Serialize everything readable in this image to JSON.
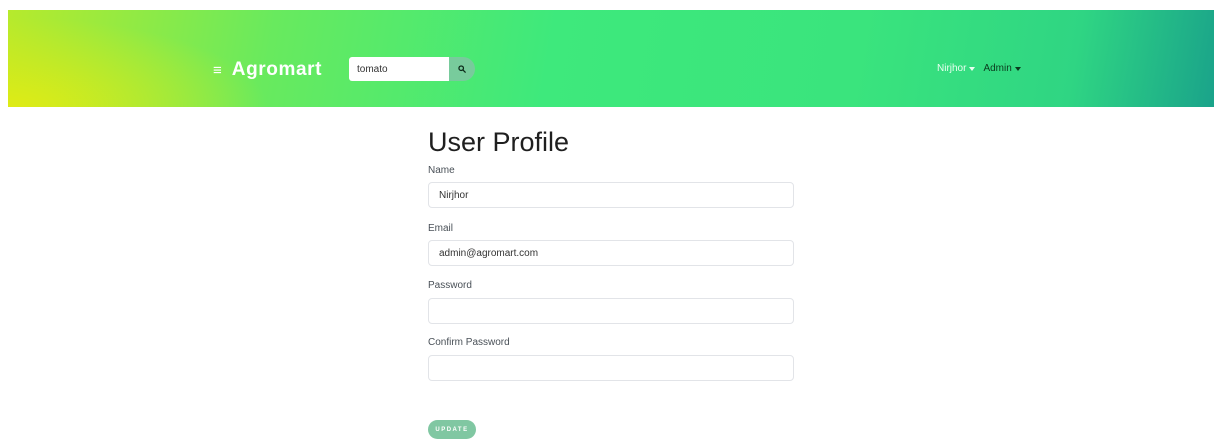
{
  "navbar": {
    "brand": "Agromart",
    "menu_icon": "≡",
    "search": {
      "value": "tomato",
      "placeholder": ""
    },
    "user_menu": "Nirjhor",
    "admin_menu": "Admin"
  },
  "profile": {
    "title": "User Profile",
    "fields": {
      "name": {
        "label": "Name",
        "value": "Nirjhor"
      },
      "email": {
        "label": "Email",
        "value": "admin@agromart.com"
      },
      "password": {
        "label": "Password",
        "value": ""
      },
      "confirm_password": {
        "label": "Confirm Password",
        "value": ""
      }
    },
    "update_label": "UPDATE"
  },
  "colors": {
    "navbar_gradient_start": "#e1eb14",
    "navbar_gradient_mid": "#3ee97c",
    "navbar_gradient_end": "#1aa38a",
    "button": "#80c7a2"
  }
}
